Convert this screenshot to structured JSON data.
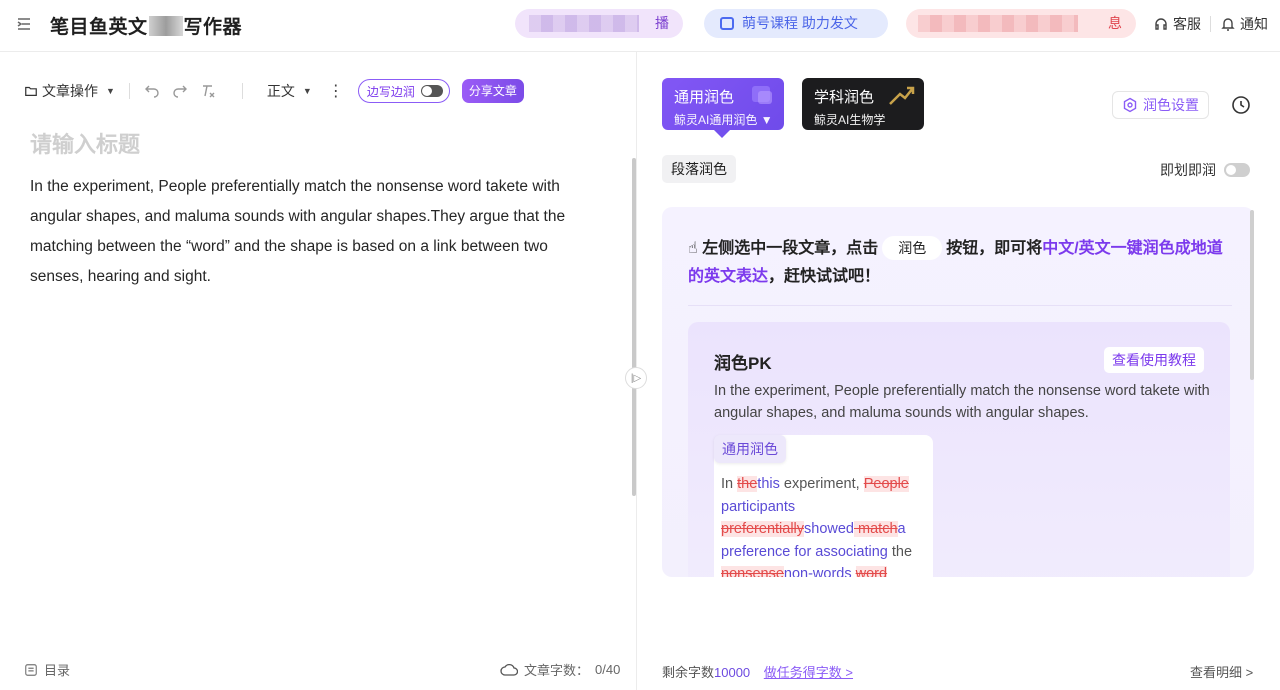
{
  "header": {
    "title_prefix": "笔目鱼英文",
    "title_suffix": "写作器",
    "pill_live": "播",
    "pill_course": "萌号课程   助力发文",
    "pill_notice": "息",
    "service": "客服",
    "notify": "通知"
  },
  "toolbar": {
    "doc_ops": "文章操作",
    "style": "正文",
    "side_write": "边写边润",
    "share": "分享文章"
  },
  "editor": {
    "title_placeholder": "请输入标题",
    "body": "In the experiment, People preferentially match the nonsense word takete with angular shapes, and maluma sounds with angular shapes.They argue that the matching between the “word” and the shape is based on a link between two senses, hearing and sight."
  },
  "footer": {
    "outline": "目录",
    "word_count_label": "文章字数：",
    "word_count_value": "0/40",
    "remaining_label": "剩余字数",
    "remaining_value": "10000",
    "task_link": "做任务得字数 >",
    "detail": "查看明细 >"
  },
  "right": {
    "mode_general_title": "通用润色",
    "mode_general_sub": "鲸灵AI通用润色",
    "mode_subject_title": "学科润色",
    "mode_subject_sub": "鲸灵AI生物学",
    "settings": "润色设置",
    "paragraph": "段落润色",
    "instant": "即划即润",
    "hint_part1": "左侧选中一段文章，点击",
    "hint_btn": "润色",
    "hint_part2": "按钮，即可将",
    "hint_highlight1": "中文/英文一键润色",
    "hint_highlight2": "成地道的英文表达",
    "hint_part3": "，赶快试试吧！",
    "pk_title": "润色PK",
    "pk_tutorial": "查看使用教程",
    "pk_text": "In the experiment, People preferentially match the nonsense word takete with angular shapes, and maluma sounds with angular shapes.",
    "compare_tag": "通用润色"
  },
  "colors": {
    "accent": "#7c3aed",
    "delete": "#e34b4b",
    "insert": "#5a4bd6"
  }
}
